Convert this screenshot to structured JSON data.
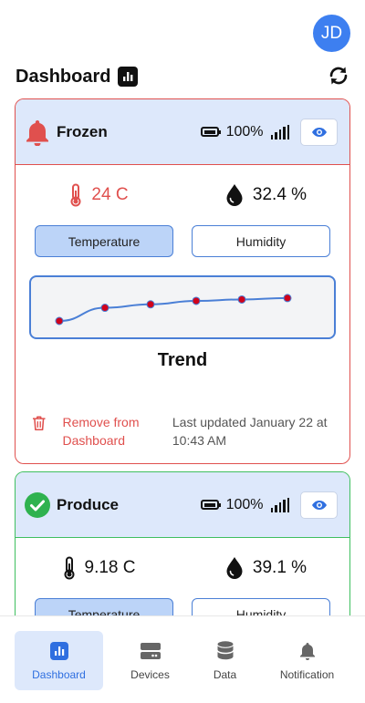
{
  "user": {
    "initials": "JD"
  },
  "page": {
    "title": "Dashboard"
  },
  "cards": [
    {
      "name": "Frozen",
      "status": "alert",
      "battery": "100%",
      "temperature": "24 C",
      "humidity": "32.4 %",
      "toggles": {
        "temperature": "Temperature",
        "humidity": "Humidity",
        "active": "temperature"
      },
      "trend_title": "Trend",
      "trend_points": [
        0.0,
        0.38,
        0.48,
        0.58,
        0.62,
        0.66
      ],
      "remove_label": "Remove from Dashboard",
      "updated": "Last updated January 22 at 10:43 AM"
    },
    {
      "name": "Produce",
      "status": "ok",
      "battery": "100%",
      "temperature": "9.18 C",
      "humidity": "39.1 %",
      "toggles": {
        "temperature": "Temperature",
        "humidity": "Humidity",
        "active": "temperature"
      }
    }
  ],
  "tabs": [
    {
      "label": "Dashboard",
      "icon": "bar-chart-icon",
      "active": true
    },
    {
      "label": "Devices",
      "icon": "server-icon",
      "active": false
    },
    {
      "label": "Data",
      "icon": "database-icon",
      "active": false
    },
    {
      "label": "Notification",
      "icon": "bell-icon",
      "active": false
    }
  ],
  "colors": {
    "accent": "#3d7ff0",
    "alert": "#e0504e",
    "ok": "#3fbf5f",
    "card_header": "#dde8fb"
  }
}
